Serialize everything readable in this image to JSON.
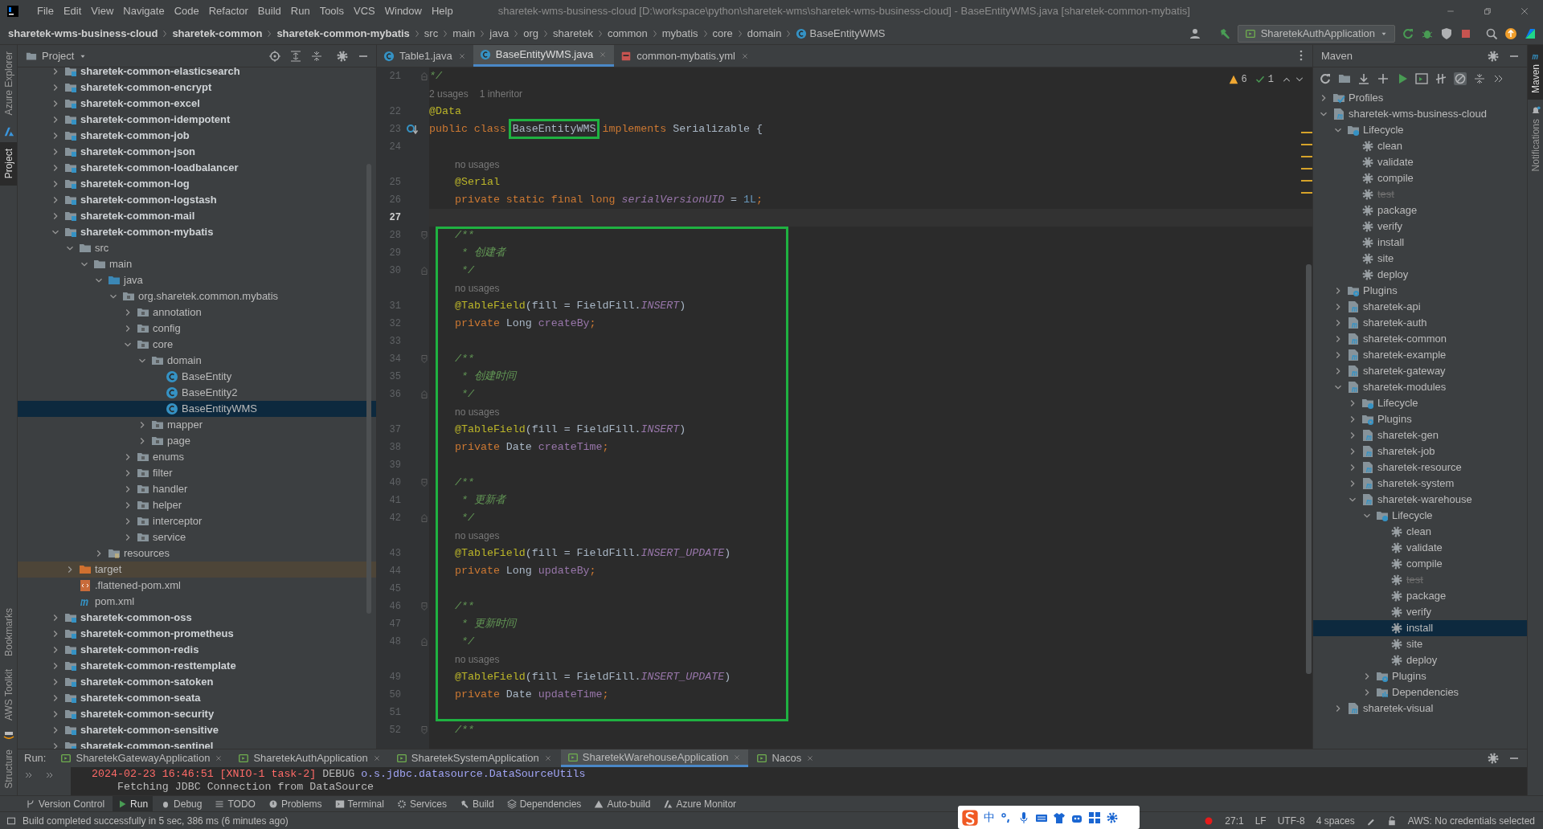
{
  "menu_bar": {
    "items": [
      "File",
      "Edit",
      "View",
      "Navigate",
      "Code",
      "Refactor",
      "Build",
      "Run",
      "Tools",
      "VCS",
      "Window",
      "Help"
    ],
    "title": "sharetek-wms-business-cloud [D:\\workspace\\python\\sharetek-wms\\sharetek-wms-business-cloud] - BaseEntityWMS.java [sharetek-common-mybatis]"
  },
  "breadcrumbs": [
    {
      "label": "sharetek-wms-business-cloud",
      "bold": true
    },
    {
      "label": "sharetek-common",
      "bold": true
    },
    {
      "label": "sharetek-common-mybatis",
      "bold": true
    },
    {
      "label": "src",
      "bold": false
    },
    {
      "label": "main",
      "bold": false
    },
    {
      "label": "java",
      "bold": false
    },
    {
      "label": "org",
      "bold": false
    },
    {
      "label": "sharetek",
      "bold": false
    },
    {
      "label": "common",
      "bold": false
    },
    {
      "label": "mybatis",
      "bold": false
    },
    {
      "label": "core",
      "bold": false
    },
    {
      "label": "domain",
      "bold": false
    },
    {
      "label": "BaseEntityWMS",
      "bold": false,
      "kind": "class"
    }
  ],
  "run_config": "SharetekAuthApplication",
  "left_strip": {
    "top": [
      {
        "label": "Azure Explorer",
        "selected": false
      },
      {
        "label": "Project",
        "selected": true
      }
    ],
    "bottom": [
      {
        "label": "Bookmarks",
        "selected": false
      },
      {
        "label": "AWS Toolkit",
        "selected": false
      },
      {
        "label": "Structure",
        "selected": false
      }
    ]
  },
  "right_strip": [
    {
      "label": "Maven",
      "selected": true
    },
    {
      "label": "Notifications",
      "selected": false
    }
  ],
  "project_panel": {
    "title": "Project",
    "items": [
      {
        "label": "sharetek-common-elasticsearch",
        "kind": "module",
        "expanded": false,
        "selected": false
      },
      {
        "label": "sharetek-common-encrypt",
        "kind": "module",
        "expanded": false,
        "selected": false
      },
      {
        "label": "sharetek-common-excel",
        "kind": "module",
        "expanded": false,
        "selected": false
      },
      {
        "label": "sharetek-common-idempotent",
        "kind": "module",
        "expanded": false,
        "selected": false
      },
      {
        "label": "sharetek-common-job",
        "kind": "module",
        "expanded": false,
        "selected": false
      },
      {
        "label": "sharetek-common-json",
        "kind": "module",
        "expanded": false,
        "selected": false
      },
      {
        "label": "sharetek-common-loadbalancer",
        "kind": "module",
        "expanded": false,
        "selected": false
      },
      {
        "label": "sharetek-common-log",
        "kind": "module",
        "expanded": false,
        "selected": false
      },
      {
        "label": "sharetek-common-logstash",
        "kind": "module",
        "expanded": false,
        "selected": false
      },
      {
        "label": "sharetek-common-mail",
        "kind": "module",
        "expanded": false,
        "selected": false
      },
      {
        "label": "sharetek-common-mybatis",
        "kind": "module",
        "expanded": true,
        "selected": false,
        "children": [
          {
            "label": "src",
            "kind": "folder",
            "expanded": true,
            "selected": false,
            "children": [
              {
                "label": "main",
                "kind": "folder",
                "expanded": true,
                "selected": false,
                "children": [
                  {
                    "label": "java",
                    "kind": "source",
                    "expanded": true,
                    "selected": false,
                    "children": [
                      {
                        "label": "org.sharetek.common.mybatis",
                        "kind": "package",
                        "expanded": true,
                        "selected": false,
                        "children": [
                          {
                            "label": "annotation",
                            "kind": "package",
                            "expanded": false,
                            "selected": false
                          },
                          {
                            "label": "config",
                            "kind": "package",
                            "expanded": false,
                            "selected": false
                          },
                          {
                            "label": "core",
                            "kind": "package",
                            "expanded": true,
                            "selected": false,
                            "children": [
                              {
                                "label": "domain",
                                "kind": "package",
                                "expanded": true,
                                "selected": false,
                                "children": [
                                  {
                                    "label": "BaseEntity",
                                    "kind": "class",
                                    "selected": false
                                  },
                                  {
                                    "label": "BaseEntity2",
                                    "kind": "class",
                                    "selected": false
                                  },
                                  {
                                    "label": "BaseEntityWMS",
                                    "kind": "class",
                                    "selected": true
                                  }
                                ]
                              },
                              {
                                "label": "mapper",
                                "kind": "package",
                                "expanded": false,
                                "selected": false
                              },
                              {
                                "label": "page",
                                "kind": "package",
                                "expanded": false,
                                "selected": false
                              }
                            ]
                          },
                          {
                            "label": "enums",
                            "kind": "package",
                            "expanded": false,
                            "selected": false
                          },
                          {
                            "label": "filter",
                            "kind": "package",
                            "expanded": false,
                            "selected": false
                          },
                          {
                            "label": "handler",
                            "kind": "package",
                            "expanded": false,
                            "selected": false
                          },
                          {
                            "label": "helper",
                            "kind": "package",
                            "expanded": false,
                            "selected": false
                          },
                          {
                            "label": "interceptor",
                            "kind": "package",
                            "expanded": false,
                            "selected": false
                          },
                          {
                            "label": "service",
                            "kind": "package",
                            "expanded": false,
                            "selected": false
                          }
                        ]
                      }
                    ]
                  },
                  {
                    "label": "resources",
                    "kind": "resources",
                    "expanded": false,
                    "selected": false
                  }
                ]
              }
            ]
          },
          {
            "label": "target",
            "kind": "excluded",
            "expanded": false,
            "selected": false
          },
          {
            "label": ".flattened-pom.xml",
            "kind": "xml",
            "selected": false
          },
          {
            "label": "pom.xml",
            "kind": "pom",
            "selected": false
          }
        ]
      },
      {
        "label": "sharetek-common-oss",
        "kind": "module",
        "expanded": false,
        "selected": false
      },
      {
        "label": "sharetek-common-prometheus",
        "kind": "module",
        "expanded": false,
        "selected": false
      },
      {
        "label": "sharetek-common-redis",
        "kind": "module",
        "expanded": false,
        "selected": false
      },
      {
        "label": "sharetek-common-resttemplate",
        "kind": "module",
        "expanded": false,
        "selected": false
      },
      {
        "label": "sharetek-common-satoken",
        "kind": "module",
        "expanded": false,
        "selected": false
      },
      {
        "label": "sharetek-common-seata",
        "kind": "module",
        "expanded": false,
        "selected": false
      },
      {
        "label": "sharetek-common-security",
        "kind": "module",
        "expanded": false,
        "selected": false
      },
      {
        "label": "sharetek-common-sensitive",
        "kind": "module",
        "expanded": false,
        "selected": false
      },
      {
        "label": "sharetek-common-sentinel",
        "kind": "module",
        "expanded": false,
        "selected": false
      }
    ]
  },
  "editor": {
    "tabs": [
      {
        "label": "Table1.java",
        "kind": "class",
        "selected": false
      },
      {
        "label": "BaseEntityWMS.java",
        "kind": "class",
        "selected": true
      },
      {
        "label": "common-mybatis.yml",
        "kind": "yaml",
        "selected": false
      }
    ],
    "warnings": "6",
    "checks": "1",
    "blocks": [
      {
        "boxed": false,
        "lines": [
          {
            "number": "21",
            "current": false,
            "fold_end": true,
            "tokens": [
              {
                "kind": "comment",
                "text": "*/"
              }
            ]
          },
          {
            "kind": "hint",
            "texts": [
              "2 usages",
              "1 inheritor"
            ]
          },
          {
            "number": "22",
            "current": false,
            "tokens": [
              {
                "kind": "annotation",
                "text": "@Data"
              }
            ]
          },
          {
            "number": "23",
            "current": false,
            "implemented": true,
            "tokens": [
              {
                "kind": "keyword",
                "text": "public class "
              },
              {
                "kind": "plain",
                "text": "BaseEntityWMS",
                "boxed": true
              },
              {
                "kind": "keyword",
                "text": " implements "
              },
              {
                "kind": "plain",
                "text": "Serializable {"
              }
            ]
          },
          {
            "number": "24",
            "current": false
          },
          {
            "kind": "hint",
            "indent": true,
            "texts": [
              "no usages"
            ]
          },
          {
            "number": "25",
            "current": false,
            "indent": true,
            "tokens": [
              {
                "kind": "annotation",
                "text": "@Serial"
              }
            ]
          },
          {
            "number": "26",
            "current": false,
            "indent": true,
            "tokens": [
              {
                "kind": "keyword",
                "text": "private static final long "
              },
              {
                "kind": "static",
                "text": "serialVersionUID"
              },
              {
                "kind": "plain",
                "text": " = "
              },
              {
                "kind": "number",
                "text": "1L"
              },
              {
                "kind": "keyword",
                "text": ";"
              }
            ]
          },
          {
            "number": "27",
            "current": true
          }
        ]
      },
      {
        "boxed": true,
        "lines": [
          {
            "number": "28",
            "current": false,
            "fold_start": true,
            "indent": true,
            "tokens": [
              {
                "kind": "comment",
                "text": "/**"
              }
            ]
          },
          {
            "number": "29",
            "current": false,
            "indent": true,
            "tokens": [
              {
                "kind": "comment",
                "text": " * 创建者"
              }
            ]
          },
          {
            "number": "30",
            "current": false,
            "fold_end": true,
            "indent": true,
            "tokens": [
              {
                "kind": "comment",
                "text": " */"
              }
            ]
          },
          {
            "kind": "hint",
            "indent": true,
            "texts": [
              "no usages"
            ]
          },
          {
            "number": "31",
            "current": false,
            "indent": true,
            "tokens": [
              {
                "kind": "annotation",
                "text": "@TableField"
              },
              {
                "kind": "plain",
                "text": "(fill = FieldFill."
              },
              {
                "kind": "static",
                "text": "INSERT"
              },
              {
                "kind": "plain",
                "text": ")"
              }
            ]
          },
          {
            "number": "32",
            "current": false,
            "indent": true,
            "tokens": [
              {
                "kind": "keyword",
                "text": "private "
              },
              {
                "kind": "plain",
                "text": "Long "
              },
              {
                "kind": "field",
                "text": "createBy"
              },
              {
                "kind": "keyword",
                "text": ";"
              }
            ]
          },
          {
            "number": "33",
            "current": false
          },
          {
            "number": "34",
            "current": false,
            "fold_start": true,
            "indent": true,
            "tokens": [
              {
                "kind": "comment",
                "text": "/**"
              }
            ]
          },
          {
            "number": "35",
            "current": false,
            "indent": true,
            "tokens": [
              {
                "kind": "comment",
                "text": " * 创建时间"
              }
            ]
          },
          {
            "number": "36",
            "current": false,
            "fold_end": true,
            "indent": true,
            "tokens": [
              {
                "kind": "comment",
                "text": " */"
              }
            ]
          },
          {
            "kind": "hint",
            "indent": true,
            "texts": [
              "no usages"
            ]
          },
          {
            "number": "37",
            "current": false,
            "indent": true,
            "tokens": [
              {
                "kind": "annotation",
                "text": "@TableField"
              },
              {
                "kind": "plain",
                "text": "(fill = FieldFill."
              },
              {
                "kind": "static",
                "text": "INSERT"
              },
              {
                "kind": "plain",
                "text": ")"
              }
            ]
          },
          {
            "number": "38",
            "current": false,
            "indent": true,
            "tokens": [
              {
                "kind": "keyword",
                "text": "private "
              },
              {
                "kind": "plain",
                "text": "Date "
              },
              {
                "kind": "field",
                "text": "createTime"
              },
              {
                "kind": "keyword",
                "text": ";"
              }
            ]
          },
          {
            "number": "39",
            "current": false
          },
          {
            "number": "40",
            "current": false,
            "fold_start": true,
            "indent": true,
            "tokens": [
              {
                "kind": "comment",
                "text": "/**"
              }
            ]
          },
          {
            "number": "41",
            "current": false,
            "indent": true,
            "tokens": [
              {
                "kind": "comment",
                "text": " * 更新者"
              }
            ]
          },
          {
            "number": "42",
            "current": false,
            "fold_end": true,
            "indent": true,
            "tokens": [
              {
                "kind": "comment",
                "text": " */"
              }
            ]
          },
          {
            "kind": "hint",
            "indent": true,
            "texts": [
              "no usages"
            ]
          },
          {
            "number": "43",
            "current": false,
            "indent": true,
            "tokens": [
              {
                "kind": "annotation",
                "text": "@TableField"
              },
              {
                "kind": "plain",
                "text": "(fill = FieldFill."
              },
              {
                "kind": "static",
                "text": "INSERT_UPDATE"
              },
              {
                "kind": "plain",
                "text": ")"
              }
            ]
          },
          {
            "number": "44",
            "current": false,
            "indent": true,
            "tokens": [
              {
                "kind": "keyword",
                "text": "private "
              },
              {
                "kind": "plain",
                "text": "Long "
              },
              {
                "kind": "field",
                "text": "updateBy"
              },
              {
                "kind": "keyword",
                "text": ";"
              }
            ]
          },
          {
            "number": "45",
            "current": false
          },
          {
            "number": "46",
            "current": false,
            "fold_start": true,
            "indent": true,
            "tokens": [
              {
                "kind": "comment",
                "text": "/**"
              }
            ]
          },
          {
            "number": "47",
            "current": false,
            "indent": true,
            "tokens": [
              {
                "kind": "comment",
                "text": " * 更新时间"
              }
            ]
          },
          {
            "number": "48",
            "current": false,
            "fold_end": true,
            "indent": true,
            "tokens": [
              {
                "kind": "comment",
                "text": " */"
              }
            ]
          },
          {
            "kind": "hint",
            "indent": true,
            "texts": [
              "no usages"
            ]
          },
          {
            "number": "49",
            "current": false,
            "indent": true,
            "tokens": [
              {
                "kind": "annotation",
                "text": "@TableField"
              },
              {
                "kind": "plain",
                "text": "(fill = FieldFill."
              },
              {
                "kind": "static",
                "text": "INSERT_UPDATE"
              },
              {
                "kind": "plain",
                "text": ")"
              }
            ]
          },
          {
            "number": "50",
            "current": false,
            "indent": true,
            "tokens": [
              {
                "kind": "keyword",
                "text": "private "
              },
              {
                "kind": "plain",
                "text": "Date "
              },
              {
                "kind": "field",
                "text": "updateTime"
              },
              {
                "kind": "keyword",
                "text": ";"
              }
            ]
          },
          {
            "number": "51",
            "current": false
          }
        ]
      },
      {
        "boxed": false,
        "lines": [
          {
            "number": "52",
            "current": false,
            "fold_start": true,
            "indent": true,
            "tokens": [
              {
                "kind": "comment",
                "text": "/**"
              }
            ]
          }
        ]
      }
    ]
  },
  "maven_panel": {
    "title": "Maven",
    "items": [
      {
        "label": "Profiles",
        "kind": "profiles",
        "expanded": false,
        "selected": false
      },
      {
        "label": "sharetek-wms-business-cloud",
        "kind": "project",
        "expanded": true,
        "selected": false,
        "children": [
          {
            "label": "Lifecycle",
            "kind": "lifecycle",
            "expanded": true,
            "selected": false,
            "children": [
              {
                "label": "clean",
                "kind": "goal",
                "disabled": false,
                "selected": false
              },
              {
                "label": "validate",
                "kind": "goal",
                "disabled": false,
                "selected": false
              },
              {
                "label": "compile",
                "kind": "goal",
                "disabled": false,
                "selected": false
              },
              {
                "label": "test",
                "kind": "goal",
                "disabled": true,
                "selected": false
              },
              {
                "label": "package",
                "kind": "goal",
                "disabled": false,
                "selected": false
              },
              {
                "label": "verify",
                "kind": "goal",
                "disabled": false,
                "selected": false
              },
              {
                "label": "install",
                "kind": "goal",
                "disabled": false,
                "selected": false
              },
              {
                "label": "site",
                "kind": "goal",
                "disabled": false,
                "selected": false
              },
              {
                "label": "deploy",
                "kind": "goal",
                "disabled": false,
                "selected": false
              }
            ]
          },
          {
            "label": "Plugins",
            "kind": "plugins",
            "expanded": false,
            "selected": false
          },
          {
            "label": "sharetek-api",
            "kind": "project",
            "expanded": false,
            "selected": false
          },
          {
            "label": "sharetek-auth",
            "kind": "project",
            "expanded": false,
            "selected": false
          },
          {
            "label": "sharetek-common",
            "kind": "project",
            "expanded": false,
            "selected": false
          },
          {
            "label": "sharetek-example",
            "kind": "project",
            "expanded": false,
            "selected": false
          },
          {
            "label": "sharetek-gateway",
            "kind": "project",
            "expanded": false,
            "selected": false
          },
          {
            "label": "sharetek-modules",
            "kind": "project",
            "expanded": true,
            "selected": false,
            "children": [
              {
                "label": "Lifecycle",
                "kind": "lifecycle",
                "expanded": false,
                "selected": false
              },
              {
                "label": "Plugins",
                "kind": "plugins",
                "expanded": false,
                "selected": false
              },
              {
                "label": "sharetek-gen",
                "kind": "project",
                "expanded": false,
                "selected": false
              },
              {
                "label": "sharetek-job",
                "kind": "project",
                "expanded": false,
                "selected": false
              },
              {
                "label": "sharetek-resource",
                "kind": "project",
                "expanded": false,
                "selected": false
              },
              {
                "label": "sharetek-system",
                "kind": "project",
                "expanded": false,
                "selected": false
              },
              {
                "label": "sharetek-warehouse",
                "kind": "project",
                "expanded": true,
                "selected": false,
                "children": [
                  {
                    "label": "Lifecycle",
                    "kind": "lifecycle",
                    "expanded": true,
                    "selected": false,
                    "children": [
                      {
                        "label": "clean",
                        "kind": "goal",
                        "disabled": false,
                        "selected": false
                      },
                      {
                        "label": "validate",
                        "kind": "goal",
                        "disabled": false,
                        "selected": false
                      },
                      {
                        "label": "compile",
                        "kind": "goal",
                        "disabled": false,
                        "selected": false
                      },
                      {
                        "label": "test",
                        "kind": "goal",
                        "disabled": true,
                        "selected": false
                      },
                      {
                        "label": "package",
                        "kind": "goal",
                        "disabled": false,
                        "selected": false
                      },
                      {
                        "label": "verify",
                        "kind": "goal",
                        "disabled": false,
                        "selected": false
                      },
                      {
                        "label": "install",
                        "kind": "goal",
                        "disabled": false,
                        "selected": true
                      },
                      {
                        "label": "site",
                        "kind": "goal",
                        "disabled": false,
                        "selected": false
                      },
                      {
                        "label": "deploy",
                        "kind": "goal",
                        "disabled": false,
                        "selected": false
                      }
                    ]
                  },
                  {
                    "label": "Plugins",
                    "kind": "plugins",
                    "expanded": false,
                    "selected": false
                  },
                  {
                    "label": "Dependencies",
                    "kind": "dependencies",
                    "expanded": false,
                    "selected": false
                  }
                ]
              }
            ]
          },
          {
            "label": "sharetek-visual",
            "kind": "project",
            "expanded": false,
            "selected": false
          }
        ]
      }
    ]
  },
  "run_panel": {
    "label": "Run:",
    "tabs": [
      {
        "label": "SharetekGatewayApplication",
        "selected": false
      },
      {
        "label": "SharetekAuthApplication",
        "selected": false
      },
      {
        "label": "SharetekSystemApplication",
        "selected": false
      },
      {
        "label": "SharetekWarehouseApplication",
        "selected": true
      },
      {
        "label": "Nacos",
        "selected": false
      }
    ],
    "console": [
      [
        {
          "kind": "time",
          "text": "2024-02-23 16:46:51 [XNIO-1 task-2]"
        },
        {
          "kind": "level",
          "text": " DEBUG "
        },
        {
          "kind": "logger",
          "text": "o.s.jdbc.datasource.DataSourceUtils"
        }
      ],
      [
        {
          "kind": "message",
          "text": "    Fetching JDBC Connection from DataSource"
        }
      ]
    ]
  },
  "tool_tabs": [
    {
      "label": "Version Control",
      "kind": "vcs",
      "selected": false
    },
    {
      "label": "Run",
      "kind": "run",
      "selected": true
    },
    {
      "label": "Debug",
      "kind": "debug",
      "selected": false
    },
    {
      "label": "TODO",
      "kind": "todo",
      "selected": false
    },
    {
      "label": "Problems",
      "kind": "problems",
      "selected": false
    },
    {
      "label": "Terminal",
      "kind": "terminal",
      "selected": false
    },
    {
      "label": "Services",
      "kind": "services",
      "selected": false
    },
    {
      "label": "Build",
      "kind": "build",
      "selected": false
    },
    {
      "label": "Dependencies",
      "kind": "dependencies",
      "selected": false
    },
    {
      "label": "Auto-build",
      "kind": "autobuild",
      "selected": false
    },
    {
      "label": "Azure Monitor",
      "kind": "azure",
      "selected": false
    }
  ],
  "ime_bar": {
    "mode": "中"
  },
  "status_bar": {
    "message": "Build completed successfully in 5 sec, 386 ms (6 minutes ago)",
    "items": [
      "27:1",
      "LF",
      "UTF-8",
      "4 spaces"
    ],
    "aws": "AWS: No credentials selected"
  }
}
